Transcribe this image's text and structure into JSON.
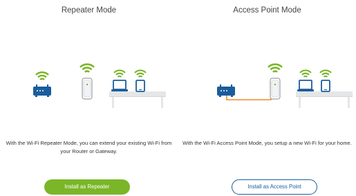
{
  "repeater": {
    "title": "Repeater Mode",
    "description": "With the Wi-Fi Repeater Mode, you can extend your existing Wi-Fi from your Router or Gateway.",
    "button_label": "Install as Repeater"
  },
  "access_point": {
    "title": "Access Point Mode",
    "description": "With the Wi-Fi Access Point Mode, you setup a new Wi-Fi for your home.",
    "button_label": "Install as Access Point"
  },
  "colors": {
    "wifi_green": "#7ab628",
    "router_blue": "#1a5d9c",
    "cable_orange": "#f08a24",
    "table_grey": "#e4e6e8",
    "button_green": "#7ab628",
    "button_outline": "#1a5d9c"
  },
  "icons": [
    "wifi-icon",
    "router-icon",
    "repeater-plug-icon",
    "laptop-icon",
    "phone-icon",
    "table-icon",
    "ethernet-cable-icon"
  ]
}
